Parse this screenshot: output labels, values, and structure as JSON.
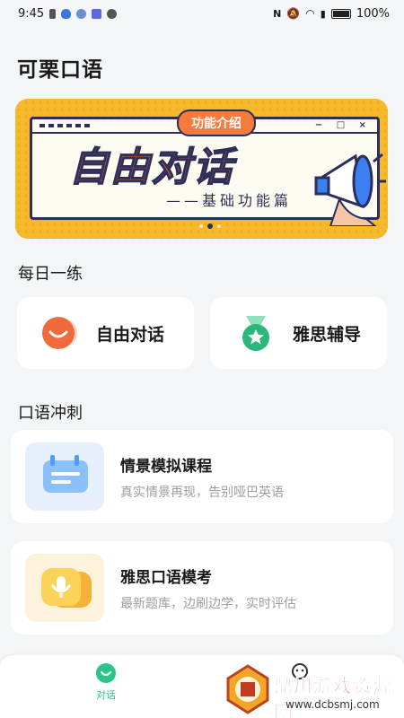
{
  "status_bar": {
    "time": "9:45",
    "battery": "100%"
  },
  "app_title": "可栗口语",
  "banner": {
    "tag": "功能介绍",
    "main_text": "自由对话",
    "sub_text": "——基础功能篇",
    "slides_total": 3,
    "slide_active": 2
  },
  "daily_practice": {
    "title": "每日一练",
    "items": [
      {
        "label": "自由对话",
        "icon": "smile-face-icon"
      },
      {
        "label": "雅思辅导",
        "icon": "medal-star-icon"
      }
    ]
  },
  "speaking_sprint": {
    "title": "口语冲刺",
    "items": [
      {
        "title": "情景模拟课程",
        "desc": "真实情景再现，告别哑巴英语",
        "icon": "calendar-icon"
      },
      {
        "title": "雅思口语模考",
        "desc": "最新题库，边刷边学，实时评估",
        "icon": "microphone-chat-icon"
      }
    ]
  },
  "bottom_nav": {
    "tabs": [
      {
        "label": "对话",
        "icon": "chat-face-icon",
        "active": true
      },
      {
        "label": "",
        "icon": "profile-icon",
        "active": false
      }
    ]
  },
  "watermark": {
    "text": "鼎川游戏资源网",
    "url": "www.dcbsmj.com"
  },
  "colors": {
    "accent": "#2bc48a",
    "orange": "#f06a3c",
    "banner_bg": "#f6b92b",
    "blue": "#4f9dfb",
    "yellow": "#f7c53b"
  }
}
